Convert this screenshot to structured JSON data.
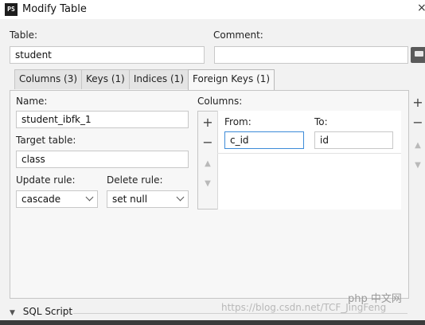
{
  "window": {
    "title": "Modify Table",
    "app_icon": "PS",
    "close_glyph": "×"
  },
  "top": {
    "table_label": "Table:",
    "table_value": "student",
    "comment_label": "Comment:",
    "comment_value": ""
  },
  "tabs": [
    {
      "label": "Columns (3)"
    },
    {
      "label": "Keys (1)"
    },
    {
      "label": "Indices (1)"
    },
    {
      "label": "Foreign Keys (1)"
    }
  ],
  "fk": {
    "name_label": "Name:",
    "name_value": "student_ibfk_1",
    "target_label": "Target table:",
    "target_value": "class",
    "update_label": "Update rule:",
    "update_value": "cascade",
    "delete_label": "Delete rule:",
    "delete_value": "set null"
  },
  "columns": {
    "label": "Columns:",
    "from_header": "From:",
    "to_header": "To:",
    "rows": [
      {
        "from": "c_id",
        "to": "id"
      }
    ]
  },
  "icons": {
    "add": "+",
    "remove": "−",
    "up": "▲",
    "down": "▼",
    "expand": "▼"
  },
  "sql_script_label": "SQL Script",
  "watermark": {
    "logo": "php 中文网",
    "text": "https://blog.csdn.net/TCF_JingFeng"
  }
}
